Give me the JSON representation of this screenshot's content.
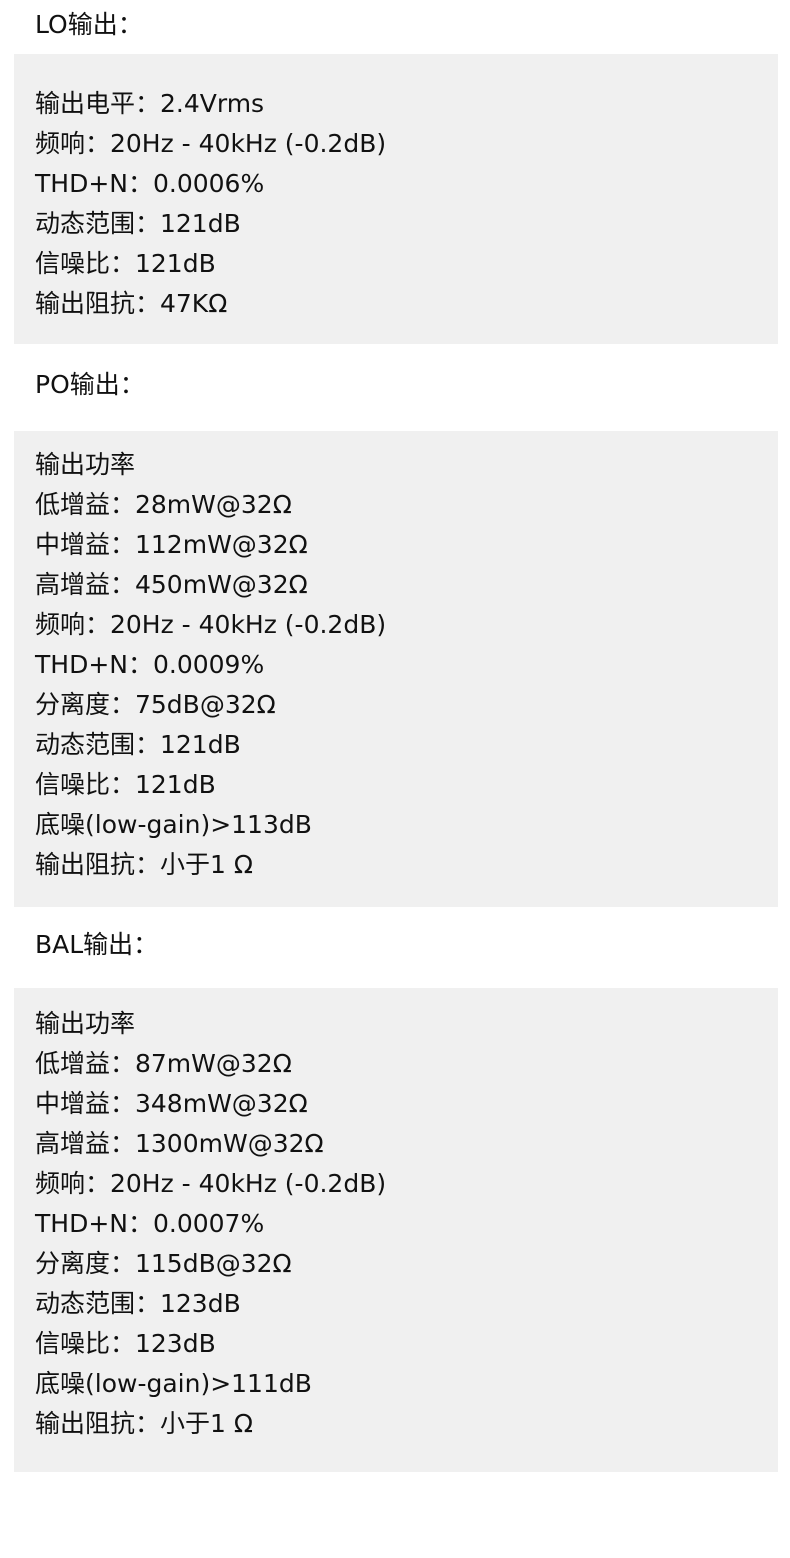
{
  "lo": {
    "title": "LO输出：",
    "lines": [
      "输出电平：2.4Vrms",
      "频响：20Hz - 40kHz (-0.2dB)",
      "THD+N：0.0006%",
      "动态范围：121dB",
      "信噪比：121dB",
      "输出阻抗：47KΩ"
    ]
  },
  "po": {
    "title": "PO输出：",
    "lines": [
      "输出功率",
      "低增益：28mW@32Ω",
      "中增益：112mW@32Ω",
      "高增益：450mW@32Ω",
      "频响：20Hz - 40kHz (-0.2dB)",
      "THD+N：0.0009%",
      "分离度：75dB@32Ω",
      "动态范围：121dB",
      "信噪比：121dB",
      "底噪(low-gain)>113dB",
      "输出阻抗：小于1 Ω"
    ]
  },
  "bal": {
    "title": "BAL输出：",
    "lines": [
      "输出功率",
      "低增益：87mW@32Ω",
      "中增益：348mW@32Ω",
      "高增益：1300mW@32Ω",
      "频响：20Hz - 40kHz (-0.2dB)",
      "THD+N：0.0007%",
      "分离度：115dB@32Ω",
      "动态范围：123dB",
      "信噪比：123dB",
      "底噪(low-gain)>111dB",
      "输出阻抗：小于1 Ω"
    ]
  }
}
